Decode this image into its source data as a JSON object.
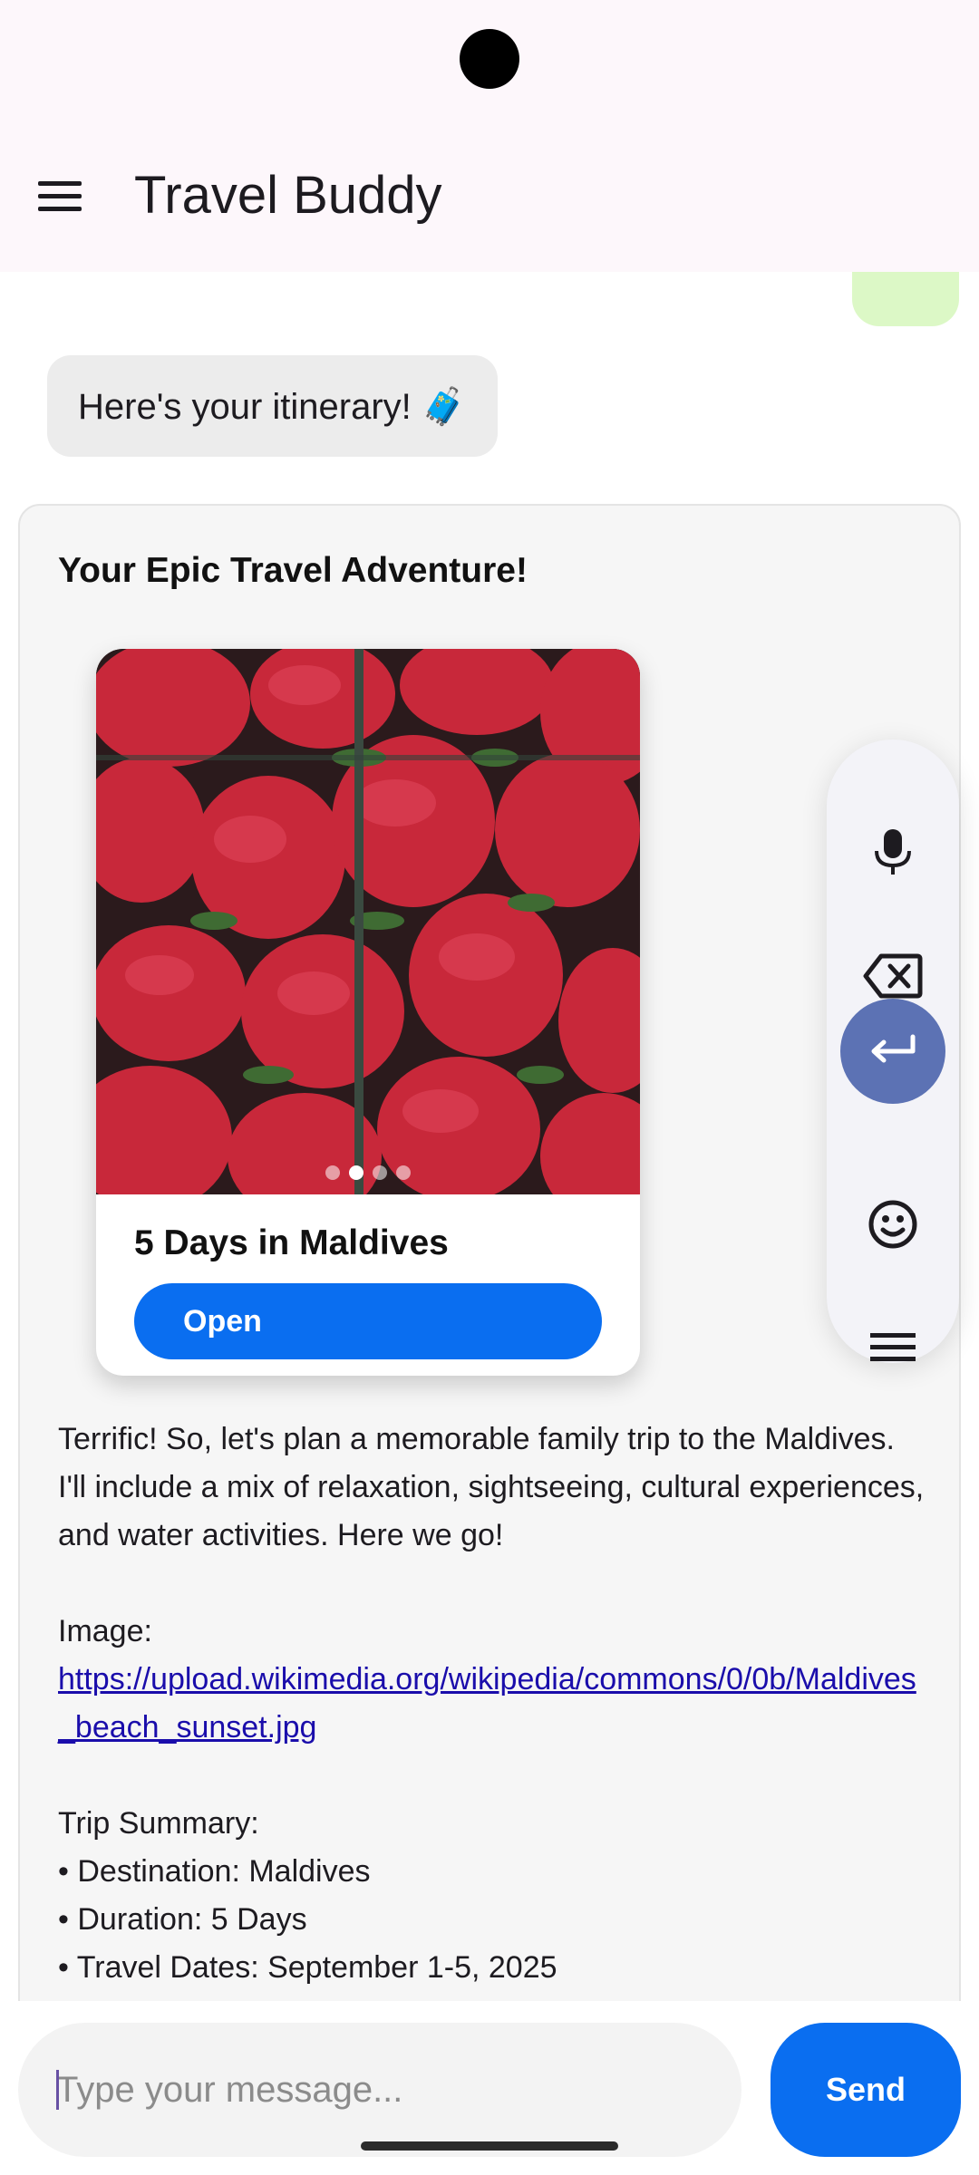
{
  "app": {
    "title": "Travel Buddy"
  },
  "chat": {
    "bot_message": "Here's your itinerary! 🧳",
    "card": {
      "title": "Your Epic Travel Adventure!",
      "destination": {
        "name": "5 Days in Maldives",
        "open_label": "Open",
        "carousel": {
          "count": 4,
          "active_index": 1
        }
      },
      "intro": "Terrific! So, let's plan a memorable family trip to the Maldives. I'll include a mix of relaxation, sightseeing, cultural experiences, and water activities. Here we go!",
      "image_label": "Image:",
      "image_url": "https://upload.wikimedia.org/wikipedia/commons/0/0b/Maldives_beach_sunset.jpg",
      "summary_heading": "Trip Summary:",
      "summary_items": [
        "• Destination: Maldives",
        "• Duration: 5 Days",
        "• Travel Dates: September 1-5, 2025"
      ]
    }
  },
  "toolbar": {
    "items": [
      "mic-icon",
      "backspace-icon",
      "enter-icon",
      "emoji-icon",
      "menu-icon"
    ],
    "accent": "#5c72b4"
  },
  "input": {
    "placeholder": "Type your message...",
    "value": ""
  },
  "send": {
    "label": "Send"
  },
  "colors": {
    "primary": "#0a6ef0",
    "app_bar": "#fdf7fb",
    "user_bubble": "#dcf8c6",
    "bot_bubble": "#ececec"
  }
}
